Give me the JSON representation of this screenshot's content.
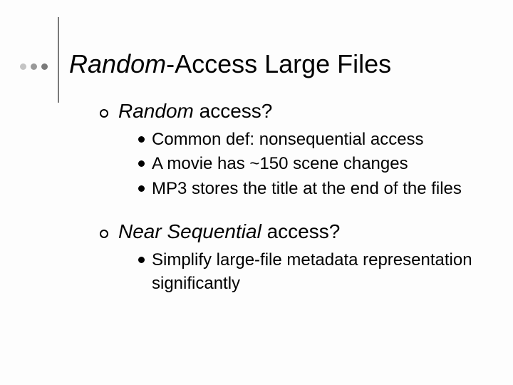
{
  "title": {
    "italic": "Random",
    "rest": "-Access Large Files"
  },
  "sections": [
    {
      "heading": {
        "italic": "Random",
        "rest": " access?"
      },
      "bullets": [
        "Common def:  nonsequential access",
        "A movie has ~150 scene changes",
        "MP3 stores the title at the end of the files"
      ]
    },
    {
      "heading": {
        "italic": "Near Sequential",
        "rest": " access?"
      },
      "bullets": [
        "Simplify large-file metadata representation significantly"
      ]
    }
  ]
}
